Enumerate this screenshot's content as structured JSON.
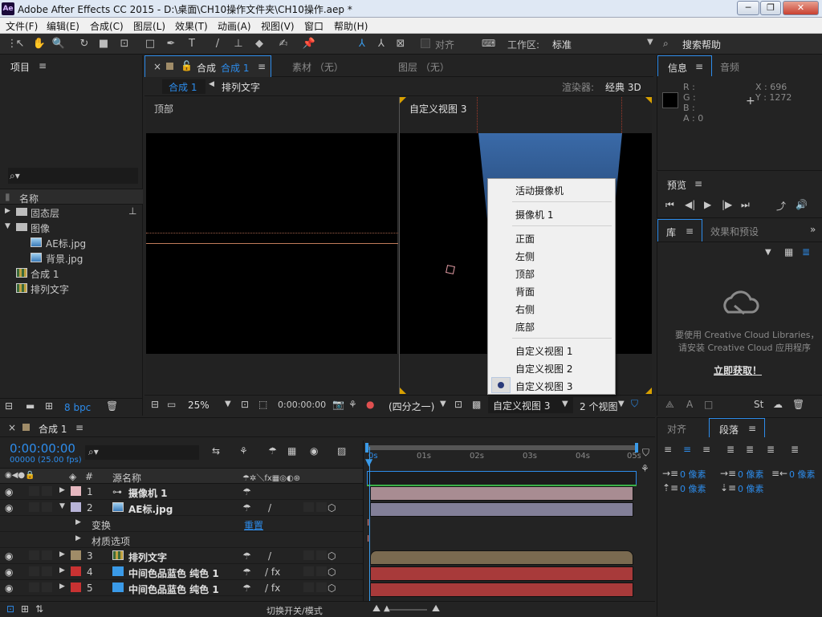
{
  "window": {
    "title": "Adobe After Effects CC 2015 - D:\\桌面\\CH10操作文件夹\\CH10操作.aep *",
    "app_icon": "Ae"
  },
  "menu": [
    "文件(F)",
    "编辑(E)",
    "合成(C)",
    "图层(L)",
    "效果(T)",
    "动画(A)",
    "视图(V)",
    "窗口",
    "帮助(H)"
  ],
  "toolbar": {
    "align_label": "对齐",
    "workspace_label": "工作区:",
    "workspace_value": "标准",
    "search_help": "搜索帮助"
  },
  "project": {
    "title": "项目",
    "name_col": "名称",
    "items": [
      {
        "label": "固态层",
        "type": "folder",
        "expanded": false
      },
      {
        "label": "图像",
        "type": "folder",
        "expanded": true
      },
      {
        "label": "AE标.jpg",
        "type": "image"
      },
      {
        "label": "背景.jpg",
        "type": "image"
      },
      {
        "label": "合成 1",
        "type": "comp"
      },
      {
        "label": "排列文字",
        "type": "comp"
      }
    ],
    "bpc": "8 bpc"
  },
  "comp_panel": {
    "tab_prefix": "合成",
    "tab_active": "合成 1",
    "footage_tab": "素材 （无）",
    "layer_tab": "图层 （无）",
    "flow_active": "合成 1",
    "flow_next": "排列文字",
    "renderer_label": "渲染器:",
    "renderer_value": "经典 3D",
    "view_left": "顶部",
    "view_right": "自定义视图 3",
    "zoom": "25%",
    "timecode": "0:00:00:00",
    "resolution": "(四分之一)",
    "view_select": "自定义视图 3",
    "view_count": "2 个视图"
  },
  "context_menu": {
    "items": [
      "活动摄像机",
      "摄像机 1",
      "正面",
      "左侧",
      "顶部",
      "背面",
      "右侧",
      "底部",
      "自定义视图 1",
      "自定义视图 2",
      "自定义视图 3"
    ],
    "checked": "自定义视图 3"
  },
  "info": {
    "title": "信息",
    "audio_tab": "音频",
    "r": "R :",
    "g": "G :",
    "b": "B :",
    "a": "A : 0",
    "x": "X : 696",
    "y": "Y : 1272"
  },
  "preview": {
    "title": "预览"
  },
  "library": {
    "title": "库",
    "effects_tab": "效果和预设",
    "msg1": "要使用 Creative Cloud Libraries，",
    "msg2": "请安装 Creative Cloud 应用程序",
    "link": "立即获取！"
  },
  "timeline": {
    "tab": "合成 1",
    "timecode": "0:00:00:00",
    "frames": "00000 (25.00 fps)",
    "col_hash": "#",
    "col_name": "源名称",
    "ruler": [
      "0s",
      "01s",
      "02s",
      "03s",
      "04s",
      "05s"
    ],
    "reset_label": "重置",
    "toggle_label": "切换开关/模式",
    "layers": [
      {
        "num": "1",
        "name": "摄像机 1",
        "color": "#e6b8c0",
        "bar": "#a88c92"
      },
      {
        "num": "2",
        "name": "AE标.jpg",
        "color": "#b8b4d8",
        "bar": "#827f98"
      },
      {
        "sub": "变换"
      },
      {
        "sub": "材质选项"
      },
      {
        "num": "3",
        "name": "排列文字",
        "color": "#a08c68",
        "bar": "#7a6a50"
      },
      {
        "num": "4",
        "name": "中间色品蓝色 纯色 1",
        "color": "#c83232",
        "bar": "#a83a3a"
      },
      {
        "num": "5",
        "name": "中间色品蓝色 纯色 1",
        "color": "#c83232",
        "bar": "#a83a3a"
      }
    ]
  },
  "paragraph": {
    "align_tab": "对齐",
    "para_tab": "段落",
    "indent_value": "0 像素"
  }
}
